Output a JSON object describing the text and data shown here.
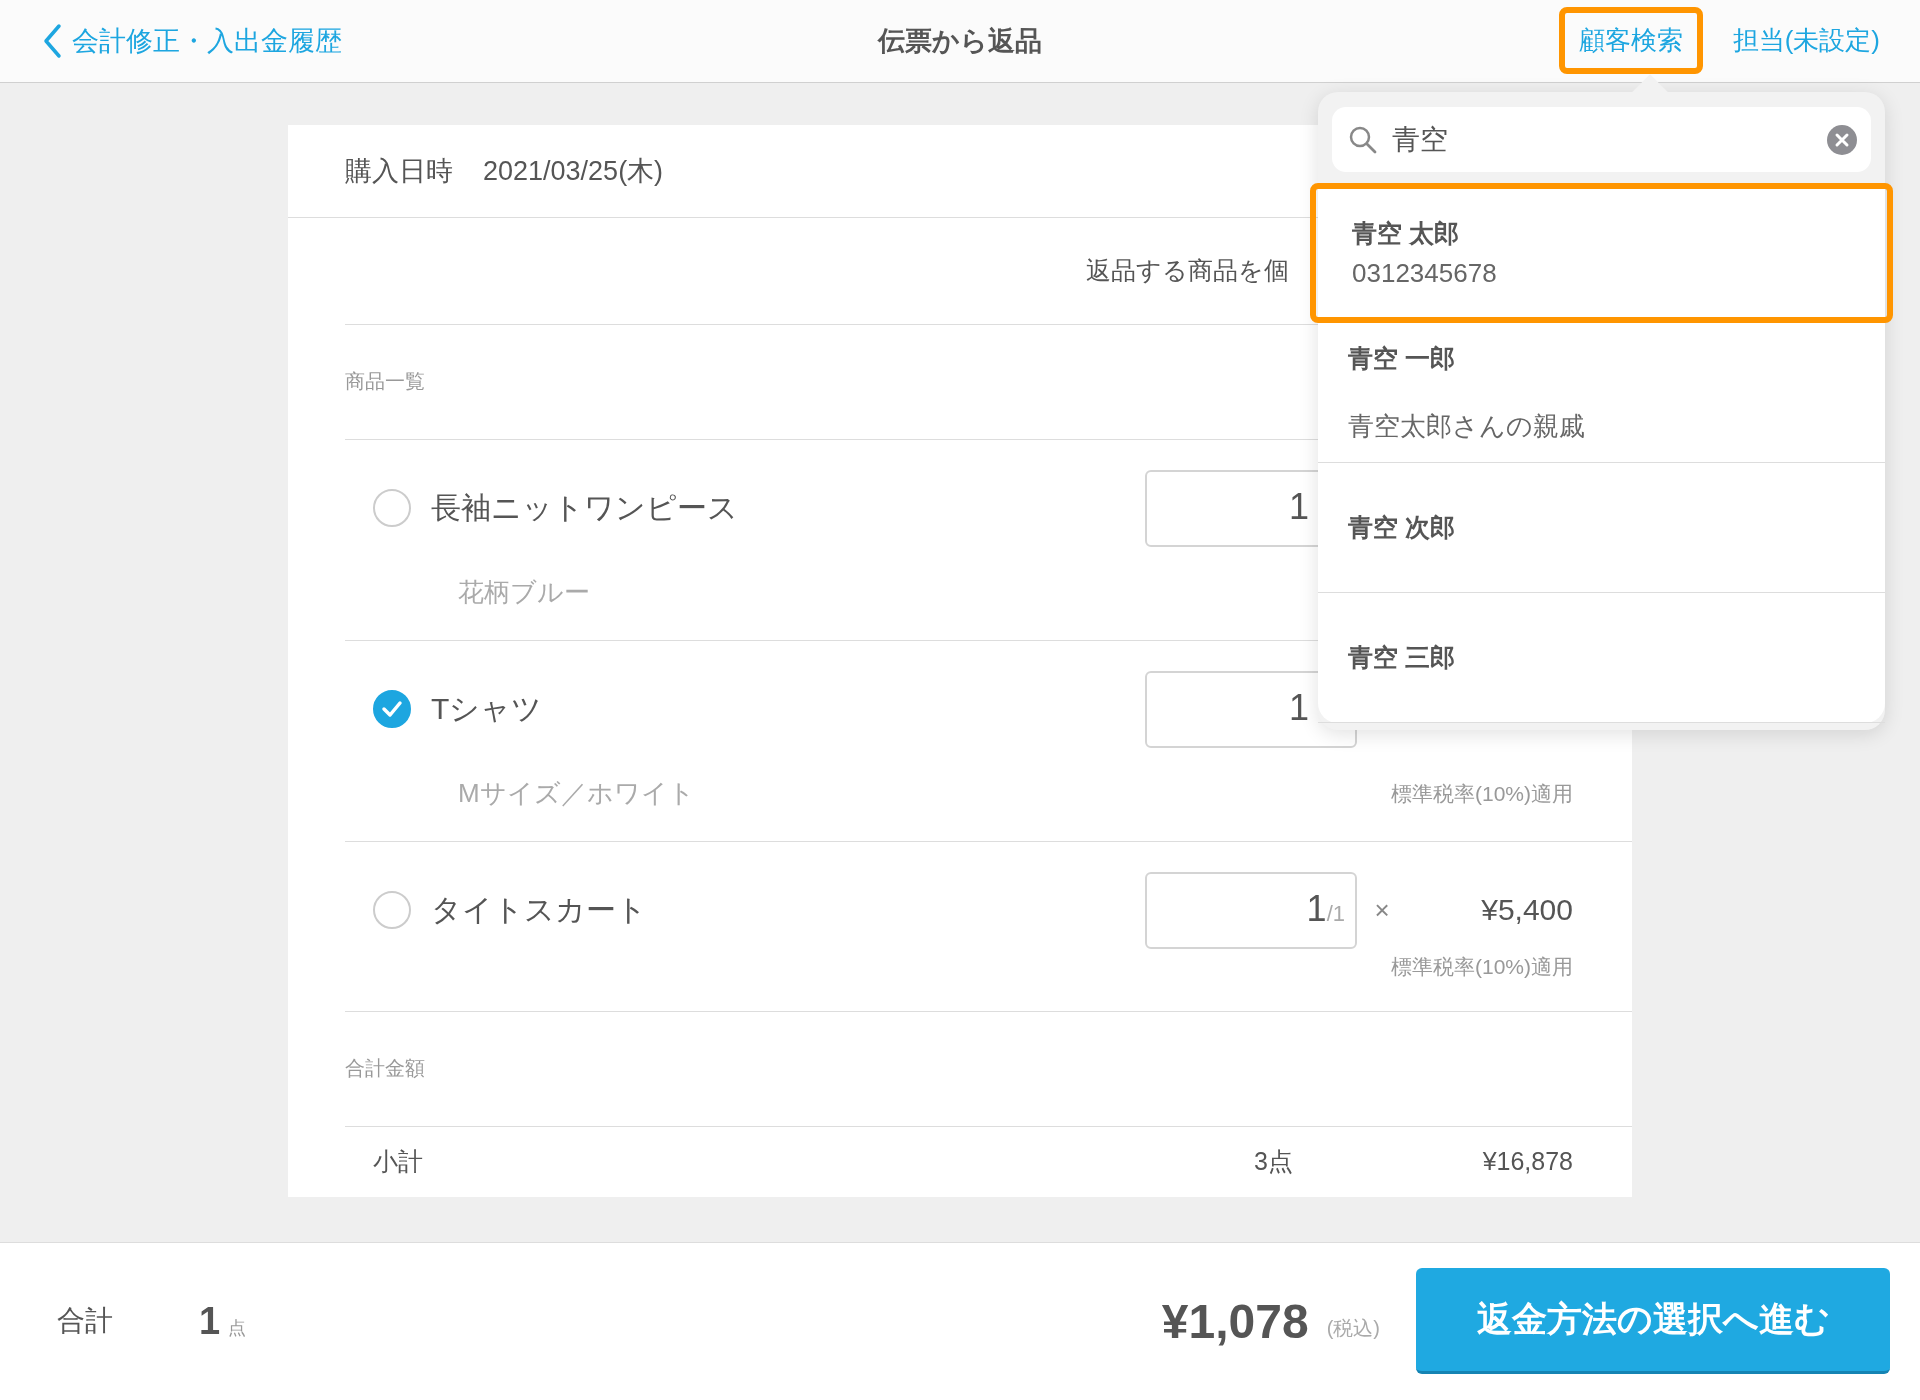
{
  "header": {
    "back_label": "会計修正・入出金履歴",
    "title": "伝票から返品",
    "actions": [
      {
        "label": "顧客検索",
        "highlighted": true
      },
      {
        "label": "担当(未設定)",
        "highlighted": false
      }
    ]
  },
  "purchase": {
    "label": "購入日時",
    "date": "2021/03/25(木)"
  },
  "instruction": "返品する商品を個",
  "items_label": "商品一覧",
  "items": [
    {
      "name": "長袖ニットワンピース",
      "variant": "花柄ブルー",
      "selected": false,
      "quantity": "1"
    },
    {
      "name": "Tシャツ",
      "variant": "Mサイズ／ホワイト",
      "selected": true,
      "quantity": "1",
      "tax_note": "標準税率(10%)適用"
    },
    {
      "name": "タイトスカート",
      "selected": false,
      "quantity": "1",
      "quantity_max": "/1",
      "times": "×",
      "price": "¥5,400",
      "tax_note": "標準税率(10%)適用"
    }
  ],
  "totals_label": "合計金額",
  "subtotal": {
    "label": "小計",
    "count": "3点",
    "amount": "¥16,878"
  },
  "footer": {
    "label": "合計",
    "count": "1",
    "count_unit": "点",
    "amount": "¥1,078",
    "tax_label": "(税込)",
    "button": "返金方法の選択へ進む"
  },
  "customer_search": {
    "query": "青空",
    "results": [
      {
        "name": "青空 太郎",
        "detail": "0312345678",
        "selected": true
      },
      {
        "name": "青空 一郎",
        "detail": "青空太郎さんの親戚",
        "selected": false
      },
      {
        "name": "青空 次郎",
        "selected": false
      },
      {
        "name": "青空 三郎",
        "selected": false
      }
    ]
  }
}
